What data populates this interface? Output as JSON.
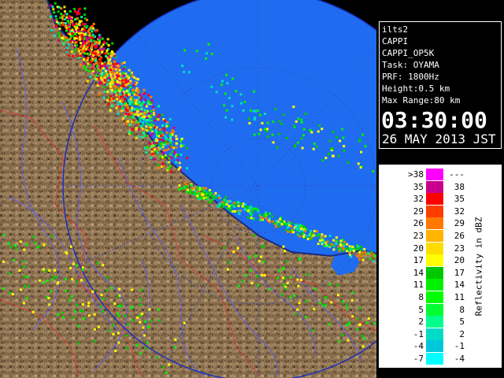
{
  "map": {
    "description_icon": "radar-map",
    "colors": {
      "sea": "#1f6cf0",
      "land": "#8c6f4a",
      "range_circle": "#1b3fd1",
      "rivers": "#5858ff",
      "boundaries": "#ff3030"
    }
  },
  "info": {
    "line1": "ilts2",
    "line2": "CAPPI",
    "line3": "CAPPI_OP5K",
    "line4": "Task: OYAMA",
    "line5": "PRF: 1800Hz",
    "line6": "Height:0.5 km",
    "line7": "Max Range:80 km",
    "time": "03:30:00",
    "date": "26 MAY 2013 JST"
  },
  "legend": {
    "title": "Reflectivity in dBZ",
    "rows": [
      {
        "lo": ">38",
        "hi": "---",
        "color": "#ff00ff"
      },
      {
        "lo": "35",
        "hi": "38",
        "color": "#c8008c"
      },
      {
        "lo": "32",
        "hi": "35",
        "color": "#ff0000"
      },
      {
        "lo": "29",
        "hi": "32",
        "color": "#ff3c00"
      },
      {
        "lo": "26",
        "hi": "29",
        "color": "#ff7800"
      },
      {
        "lo": "23",
        "hi": "26",
        "color": "#ffb400"
      },
      {
        "lo": "20",
        "hi": "23",
        "color": "#ffdc00"
      },
      {
        "lo": "17",
        "hi": "20",
        "color": "#ffff00"
      },
      {
        "lo": "14",
        "hi": "17",
        "color": "#00c800"
      },
      {
        "lo": "11",
        "hi": "14",
        "color": "#00f000"
      },
      {
        "lo": "8",
        "hi": "11",
        "color": "#00ff00"
      },
      {
        "lo": "5",
        "hi": "8",
        "color": "#00ff32"
      },
      {
        "lo": "2",
        "hi": "5",
        "color": "#00ff8c"
      },
      {
        "lo": "-1",
        "hi": "2",
        "color": "#00dcc8"
      },
      {
        "lo": "-4",
        "hi": "-1",
        "color": "#00c8dc"
      },
      {
        "lo": "-7",
        "hi": "-4",
        "color": "#00ffff"
      }
    ]
  }
}
